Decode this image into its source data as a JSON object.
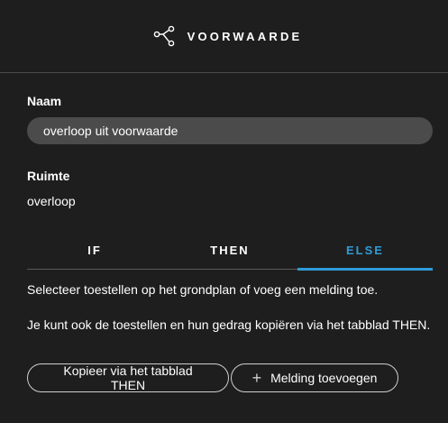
{
  "header": {
    "title": "VOORWAARDE",
    "icon": "share-nodes-icon"
  },
  "form": {
    "name_label": "Naam",
    "name_value": "overloop uit voorwaarde",
    "space_label": "Ruimte",
    "space_value": "overloop"
  },
  "tabs": {
    "items": [
      {
        "label": "IF",
        "active": false
      },
      {
        "label": "THEN",
        "active": false
      },
      {
        "label": "ELSE",
        "active": true
      }
    ],
    "accent_color": "#2e9bd6"
  },
  "content": {
    "message1": "Selecteer toestellen op het grondplan of voeg een melding toe.",
    "message2": "Je kunt ook de toestellen en hun gedrag kopiëren via het tabblad THEN."
  },
  "buttons": {
    "copy_label": "Kopieer via het tabblad THEN",
    "add_label": "Melding toevoegen",
    "add_icon": "plus-icon"
  }
}
